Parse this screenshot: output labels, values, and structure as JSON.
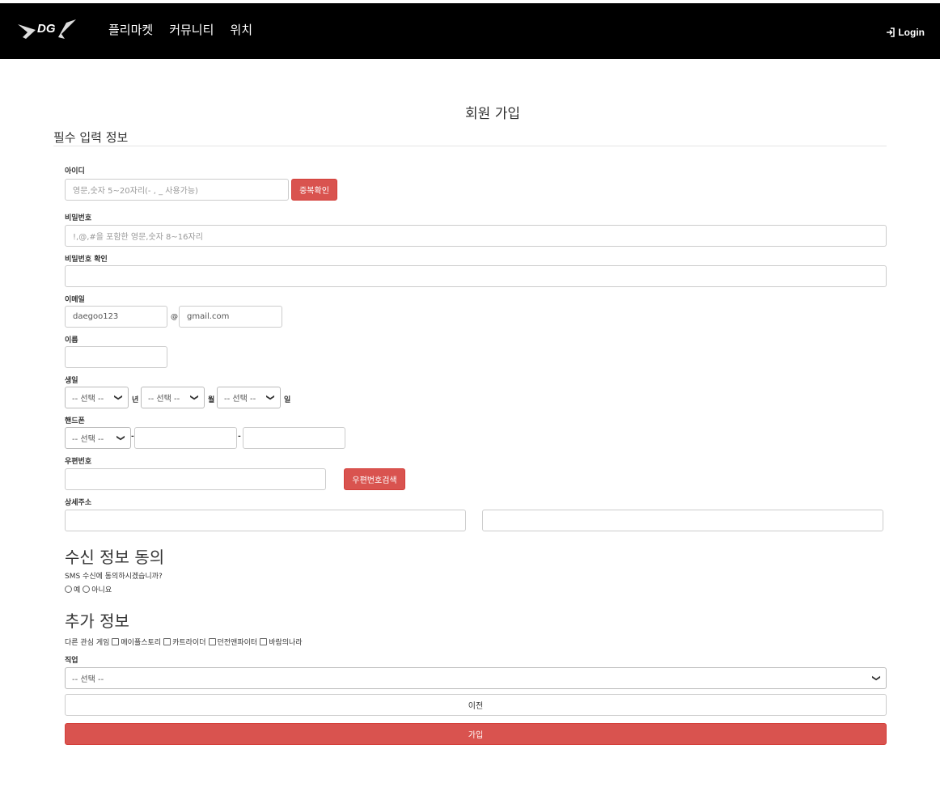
{
  "header": {
    "logo_text": "DG",
    "nav": [
      "플리마켓",
      "커뮤니티",
      "위치"
    ],
    "login_label": "Login"
  },
  "page_title": "회원 가입",
  "required_section": "필수 입력 정보",
  "form": {
    "id_label": "아이디",
    "id_placeholder": "영문,숫자 5~20자리(- , _ 사용가능)",
    "id_check_button": "중복확인",
    "pw_label": "비밀번호",
    "pw_placeholder": "!,@,#을 포함한 영문,숫자 8~16자리",
    "pw_confirm_label": "비밀번호 확인",
    "email_label": "이메일",
    "email_user": "daegoo123",
    "email_at": "@",
    "email_domain": "gmail.com",
    "name_label": "이름",
    "birth_label": "생일",
    "birth_year": "-- 선택 --",
    "birth_year_suffix": "년",
    "birth_month": "-- 선택 --",
    "birth_month_suffix": "월",
    "birth_day": "-- 선택 --",
    "birth_day_suffix": "일",
    "phone_label": "핸드폰",
    "phone_prefix": "-- 선택 --",
    "phone_dash": "-",
    "zip_label": "우편번호",
    "zip_button": "우편번호검색",
    "address_label": "상세주소"
  },
  "consent": {
    "title": "수신 정보 동의",
    "question": "SMS 수신에 동의하시겠습니까?",
    "yes": "예",
    "no": "아니요"
  },
  "extra": {
    "title": "추가 정보",
    "games_label": "다른 관심 게임",
    "games": [
      "메이플스토리",
      "카트라이더",
      "던전앤파이터",
      "바람의나라"
    ],
    "job_label": "직업",
    "job_select": "-- 선택 --"
  },
  "buttons": {
    "prev": "이전",
    "join": "가입"
  }
}
